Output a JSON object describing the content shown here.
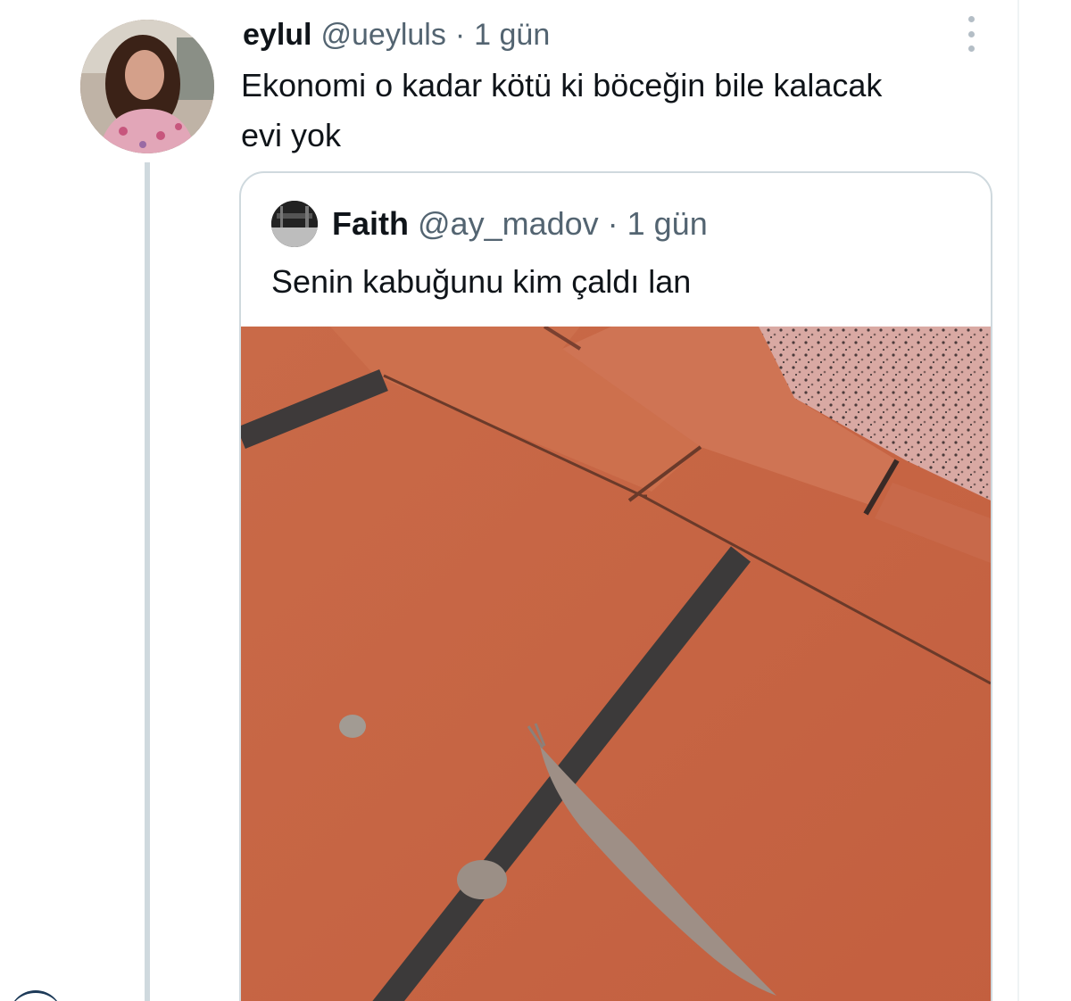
{
  "tweet": {
    "display_name": "eylul",
    "handle": "@ueyluls",
    "separator": "·",
    "time": "1 gün",
    "text_line1": "Ekonomi o kadar kötü ki böceğin bile kalacak",
    "text_line2": "evi yok",
    "avatar_icon": "profile-photo"
  },
  "quote": {
    "display_name": "Faith",
    "handle": "@ay_madov",
    "separator": "·",
    "time": "1 gün",
    "text": "Senin kabuğunu kim çaldı lan",
    "media": "photo-slug-on-brick-pavement"
  },
  "icons": {
    "more": "more-vertical-icon"
  },
  "colors": {
    "text_primary": "#0f1419",
    "text_secondary": "#536471",
    "border": "#cfd9de",
    "brick": "#c8704f"
  }
}
